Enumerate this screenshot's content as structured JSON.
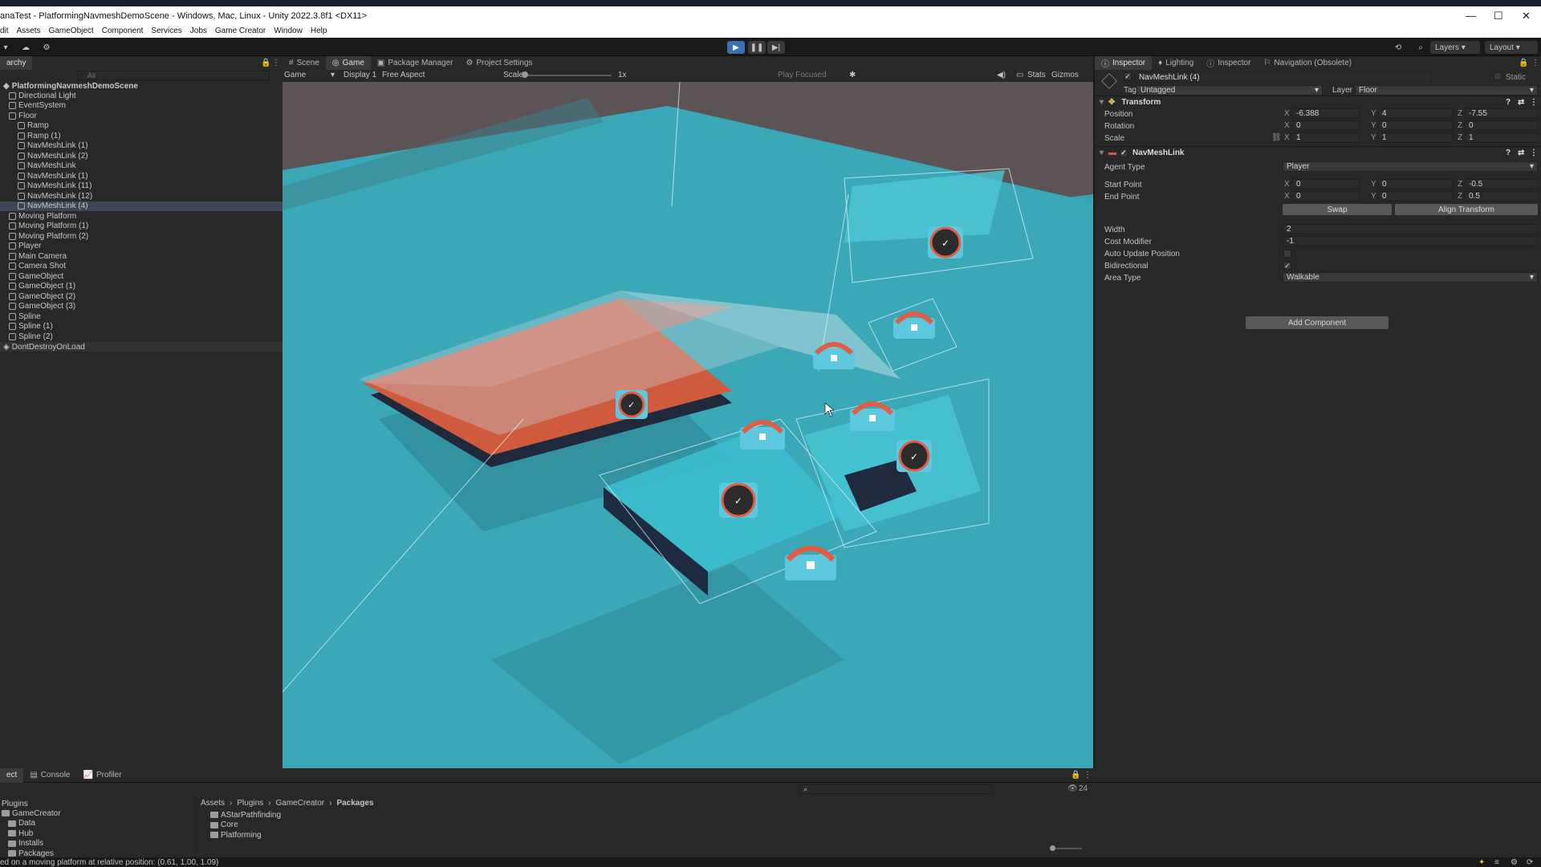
{
  "window": {
    "title": "anaTest - PlatformingNavmeshDemoScene - Windows, Mac, Linux - Unity 2022.3.8f1 <DX11>",
    "controls": [
      "—",
      "☐",
      "✕"
    ]
  },
  "menu": [
    "dit",
    "Assets",
    "GameObject",
    "Component",
    "Services",
    "Jobs",
    "Game Creator",
    "Window",
    "Help"
  ],
  "toolbar": {
    "layers": "Layers",
    "layout": "Layout"
  },
  "hierarchy": {
    "tab": "archy",
    "search_placeholder": "All",
    "scene": "PlatformingNavmeshDemoScene",
    "items": [
      {
        "label": "Directional Light",
        "indent": 1
      },
      {
        "label": "EventSystem",
        "indent": 1
      },
      {
        "label": "Floor",
        "indent": 1
      },
      {
        "label": "Ramp",
        "indent": 2
      },
      {
        "label": "Ramp (1)",
        "indent": 2
      },
      {
        "label": "NavMeshLink (1)",
        "indent": 2
      },
      {
        "label": "NavMeshLink (2)",
        "indent": 2
      },
      {
        "label": "NavMeshLink",
        "indent": 2
      },
      {
        "label": "NavMeshLink (1)",
        "indent": 2
      },
      {
        "label": "NavMeshLink (11)",
        "indent": 2
      },
      {
        "label": "NavMeshLink (12)",
        "indent": 2
      },
      {
        "label": "NavMeshLink (4)",
        "indent": 2,
        "selected": true
      },
      {
        "label": "Moving Platform",
        "indent": 1
      },
      {
        "label": "Moving Platform (1)",
        "indent": 1
      },
      {
        "label": "Moving Platform (2)",
        "indent": 1
      },
      {
        "label": "Player",
        "indent": 1
      },
      {
        "label": "Main Camera",
        "indent": 1
      },
      {
        "label": "Camera Shot",
        "indent": 1
      },
      {
        "label": "GameObject",
        "indent": 1
      },
      {
        "label": "GameObject (1)",
        "indent": 1
      },
      {
        "label": "GameObject (2)",
        "indent": 1
      },
      {
        "label": "GameObject (3)",
        "indent": 1
      },
      {
        "label": "Spline",
        "indent": 1
      },
      {
        "label": "Spline (1)",
        "indent": 1
      },
      {
        "label": "Spline (2)",
        "indent": 1
      }
    ],
    "dontdestroy": "DontDestroyOnLoad"
  },
  "center_tabs": [
    "Scene",
    "Game",
    "Package Manager",
    "Project Settings"
  ],
  "game_bar": {
    "mode": "Game",
    "display": "Display 1",
    "aspect": "Free Aspect",
    "scale_label": "Scale",
    "scale_value": "1x",
    "play_focused": "Play Focused",
    "stats": "Stats",
    "gizmos": "Gizmos"
  },
  "inspector": {
    "tabs": [
      "Inspector",
      "Lighting",
      "Inspector",
      "Navigation (Obsolete)"
    ],
    "object_name": "NavMeshLink (4)",
    "static_label": "Static",
    "tag_label": "Tag",
    "tag_value": "Untagged",
    "layer_label": "Layer",
    "layer_value": "Floor",
    "transform": {
      "title": "Transform",
      "position": {
        "label": "Position",
        "x": "-6.388",
        "y": "4",
        "z": "-7.55"
      },
      "rotation": {
        "label": "Rotation",
        "x": "0",
        "y": "0",
        "z": "0"
      },
      "scale": {
        "label": "Scale",
        "x": "1",
        "y": "1",
        "z": "1"
      }
    },
    "navmeshlink": {
      "title": "NavMeshLink",
      "agent_type_label": "Agent Type",
      "agent_type": "Player",
      "start_label": "Start Point",
      "start": {
        "x": "0",
        "y": "0",
        "z": "-0.5"
      },
      "end_label": "End Point",
      "end": {
        "x": "0",
        "y": "0",
        "z": "0.5"
      },
      "swap": "Swap",
      "align": "Align Transform",
      "width_label": "Width",
      "width": "2",
      "cost_label": "Cost Modifier",
      "cost": "-1",
      "auto_update_label": "Auto Update Position",
      "auto_update": false,
      "bidirectional_label": "Bidirectional",
      "bidirectional": true,
      "area_label": "Area Type",
      "area": "Walkable"
    },
    "add_component": "Add Component"
  },
  "bottom": {
    "tabs": [
      "ect",
      "Console",
      "Profiler"
    ],
    "tree_root": "Plugins",
    "tree": [
      {
        "label": "GameCreator",
        "indent": 0
      },
      {
        "label": "Data",
        "indent": 1
      },
      {
        "label": "Hub",
        "indent": 1
      },
      {
        "label": "Installs",
        "indent": 1
      },
      {
        "label": "Packages",
        "indent": 1
      }
    ],
    "breadcrumb": [
      "Assets",
      "Plugins",
      "GameCreator",
      "Packages"
    ],
    "folders": [
      "AStarPathfinding",
      "Core",
      "Platforming"
    ],
    "hidden_count": "24"
  },
  "status": "ed on a moving platform at relative position: (0.61, 1.00, 1.09)",
  "colors": {
    "accent_blue": "#4a90d9",
    "scene_teal": "#3aa6b5",
    "platform_red": "#e06049"
  }
}
